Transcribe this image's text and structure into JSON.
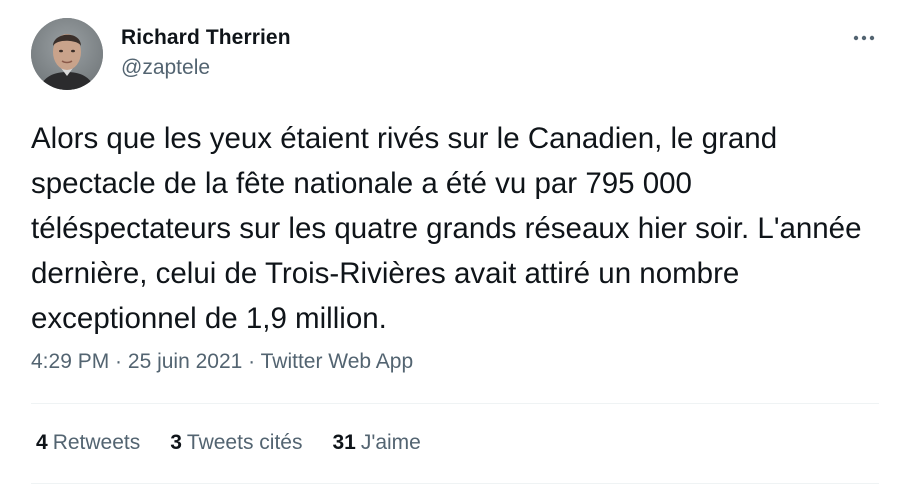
{
  "author": {
    "display_name": "Richard Therrien",
    "handle": "@zaptele",
    "avatar_icon": "profile-photo"
  },
  "more_icon": "more-horizontal-icon",
  "tweet": {
    "text": "Alors que les yeux étaient rivés sur le Canadien, le grand spectacle de la fête nationale a été vu par 795 000 téléspectateurs sur les quatre grands réseaux hier soir. L'année dernière, celui de Trois-Rivières avait attiré un nombre exceptionnel de 1,9 million.",
    "time": "4:29 PM",
    "separator": " · ",
    "date": "25 juin 2021",
    "app": "Twitter Web App"
  },
  "stats": {
    "retweets_count": "4",
    "retweets_label": "Retweets",
    "quotes_count": "3",
    "quotes_label": "Tweets cités",
    "likes_count": "31",
    "likes_label": "J'aime"
  },
  "colors": {
    "text_primary": "#0f1419",
    "text_secondary": "#536471",
    "divider": "#eff3f4"
  }
}
